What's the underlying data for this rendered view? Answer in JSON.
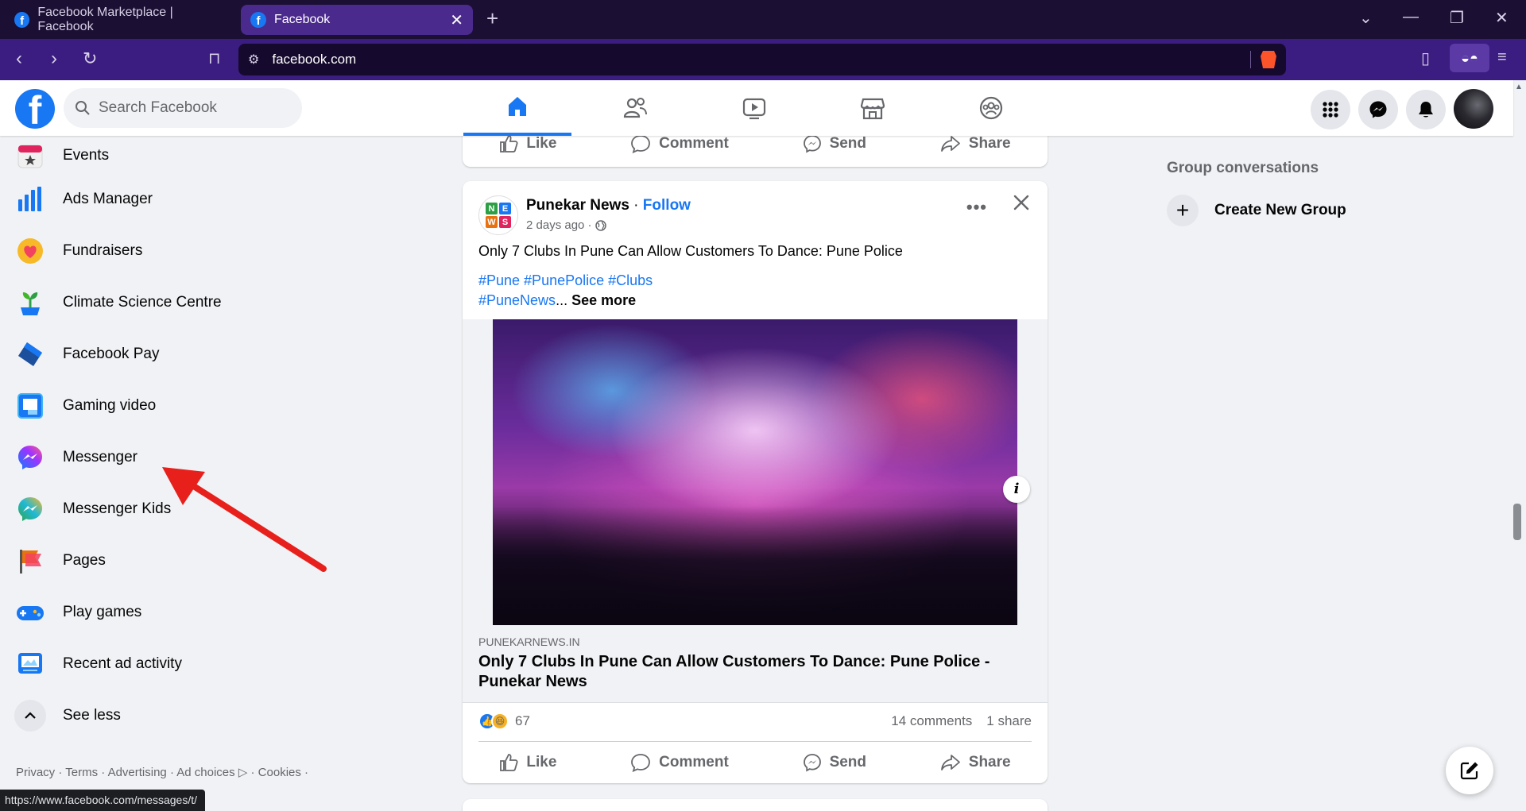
{
  "browser": {
    "tabs": [
      {
        "title": "Facebook Marketplace | Facebook",
        "active": false
      },
      {
        "title": "Facebook",
        "active": true
      }
    ],
    "url": "facebook.com",
    "status_url": "https://www.facebook.com/messages/t/",
    "accent_color": "#3b1c80"
  },
  "header": {
    "search_placeholder": "Search Facebook",
    "nav_tabs": [
      "home-icon",
      "friends-icon",
      "watch-icon",
      "marketplace-icon",
      "groups-icon"
    ],
    "active_tab": "home-icon"
  },
  "sidebar": {
    "items": [
      {
        "label": "Events",
        "icon": "events-icon"
      },
      {
        "label": "Ads Manager",
        "icon": "ads-manager-icon"
      },
      {
        "label": "Fundraisers",
        "icon": "fundraisers-icon"
      },
      {
        "label": "Climate Science Centre",
        "icon": "climate-icon"
      },
      {
        "label": "Facebook Pay",
        "icon": "facebook-pay-icon"
      },
      {
        "label": "Gaming video",
        "icon": "gaming-video-icon"
      },
      {
        "label": "Messenger",
        "icon": "messenger-icon"
      },
      {
        "label": "Messenger Kids",
        "icon": "messenger-kids-icon"
      },
      {
        "label": "Pages",
        "icon": "pages-icon"
      },
      {
        "label": "Play games",
        "icon": "play-games-icon"
      },
      {
        "label": "Recent ad activity",
        "icon": "recent-ad-activity-icon"
      }
    ],
    "see_less": "See less",
    "footer": "Privacy · Terms · Advertising · Ad choices ▷ · Cookies ·"
  },
  "feed": {
    "prev_post_actions": [
      "Like",
      "Comment",
      "Send",
      "Share"
    ],
    "post": {
      "author": "Punekar News",
      "dot": " · ",
      "follow": "Follow",
      "time": "2 days ago ·",
      "text": "Only 7 Clubs In Pune Can Allow Customers To Dance: Pune Police",
      "hashtags_line1": "#Pune #PunePolice #Clubs",
      "hashtags_line2": "#PuneNews",
      "ellipsis": "...",
      "see_more": "See more",
      "logo_letters": [
        "N",
        "E",
        "W",
        "S"
      ],
      "link_domain": "PUNEKARNEWS.IN",
      "link_title": "Only 7 Clubs In Pune Can Allow Customers To Dance: Pune Police - Punekar News",
      "reaction_count": "67",
      "comments": "14 comments",
      "shares": "1 share",
      "actions": [
        "Like",
        "Comment",
        "Send",
        "Share"
      ]
    }
  },
  "right": {
    "heading": "Group conversations",
    "create_group": "Create New Group"
  }
}
